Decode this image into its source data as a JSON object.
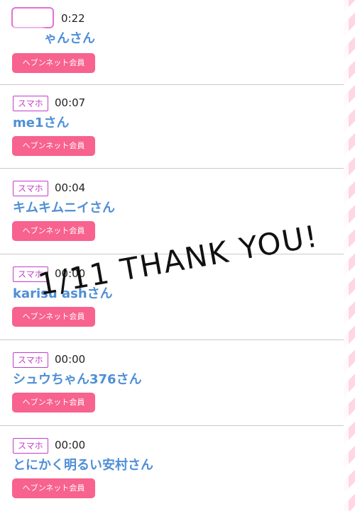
{
  "overlay": {
    "text": "1/11 THANK YOU!"
  },
  "rows": [
    {
      "badge": "",
      "time": "0:22",
      "name": "ゃんさん",
      "member": "ヘブンネット会員"
    },
    {
      "badge": "スマホ",
      "time": "00:07",
      "name": "me1さん",
      "member": "ヘブンネット会員"
    },
    {
      "badge": "スマホ",
      "time": "00:04",
      "name": "キムキムニイさん",
      "member": "ヘブンネット会員"
    },
    {
      "badge": "スマホ",
      "time": "00:00",
      "name": "karisu ashさん",
      "member": "ヘブンネット会員"
    },
    {
      "badge": "スマホ",
      "time": "00:00",
      "name": "シュウちゃん376さん",
      "member": "ヘブンネット会員"
    },
    {
      "badge": "スマホ",
      "time": "00:00",
      "name": "とにかく明るい安村さん",
      "member": "ヘブンネット会員"
    }
  ],
  "colors": {
    "badge": "#c03fc6",
    "name": "#4f8fd6",
    "member_button": "#f8628e"
  }
}
